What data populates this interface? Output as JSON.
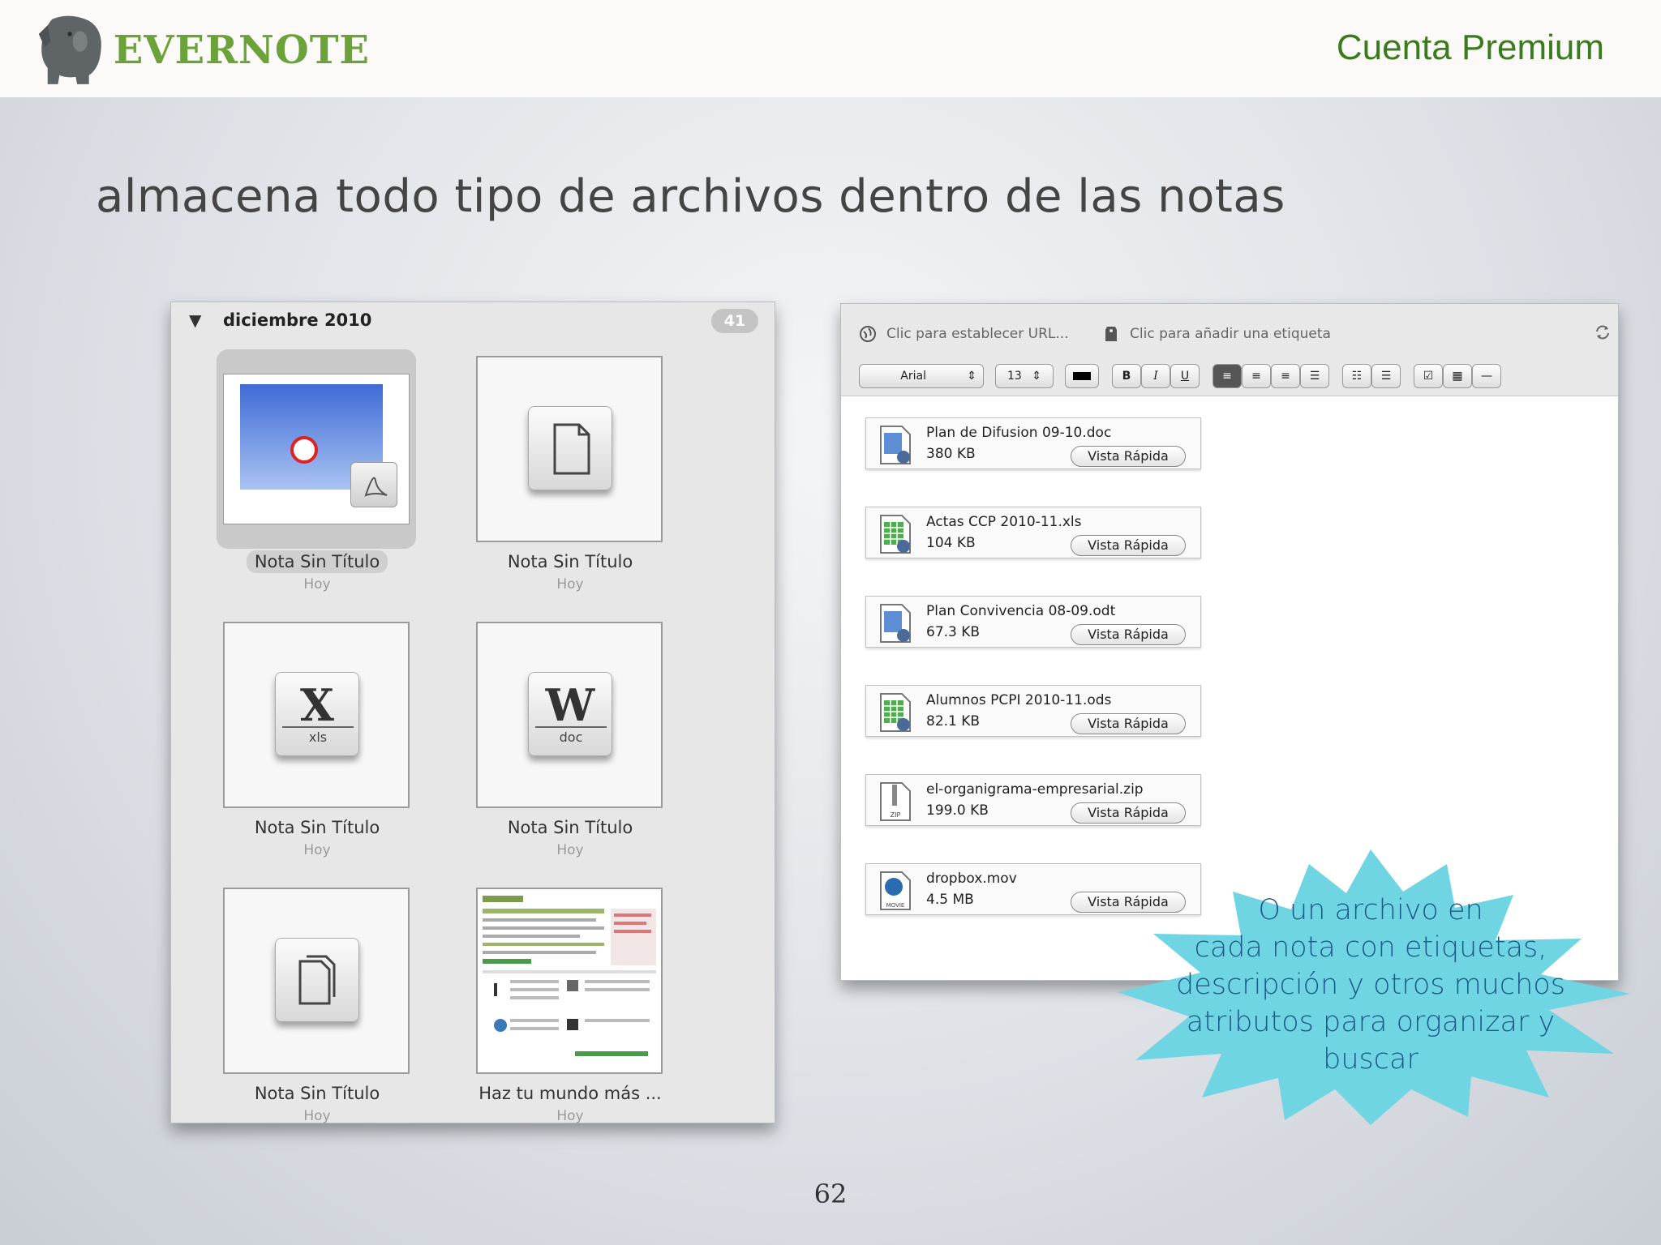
{
  "header": {
    "logo_text": "EVERNOTE",
    "section": "Cuenta Premium"
  },
  "slide": {
    "title": "almacena todo tipo de archivos dentro de las notas",
    "page_number": "62"
  },
  "notes_panel": {
    "month": "diciembre 2010",
    "count": "41",
    "notes": [
      {
        "title": "Nota Sin Título",
        "date": "Hoy",
        "thumb": "pdf-slide",
        "selected": true
      },
      {
        "title": "Nota Sin Título",
        "date": "Hoy",
        "thumb": "generic-file"
      },
      {
        "title": "Nota Sin Título",
        "date": "Hoy",
        "thumb": "xls",
        "letter": "X",
        "ext": "xls"
      },
      {
        "title": "Nota Sin Título",
        "date": "Hoy",
        "thumb": "doc",
        "letter": "W",
        "ext": "doc"
      },
      {
        "title": "Nota Sin Título",
        "date": "Hoy",
        "thumb": "copy-file"
      },
      {
        "title": "Haz tu mundo más ...",
        "date": "Hoy",
        "thumb": "webpage"
      }
    ]
  },
  "editor": {
    "url_placeholder": "Clic para establecer URL...",
    "tag_placeholder": "Clic para añadir una etiqueta",
    "font": "Arial",
    "size": "13",
    "bold": "B",
    "italic": "I",
    "underline": "U",
    "quick_look_label": "Vista Rápida",
    "attachments": [
      {
        "name": "Plan de Difusion 09-10.doc",
        "size": "380 KB",
        "icon": "document-icon"
      },
      {
        "name": "Actas CCP 2010-11.xls",
        "size": "104 KB",
        "icon": "spreadsheet-icon"
      },
      {
        "name": "Plan Convivencia 08-09.odt",
        "size": "67.3 KB",
        "icon": "document-icon"
      },
      {
        "name": "Alumnos PCPI 2010-11.ods",
        "size": "82.1 KB",
        "icon": "spreadsheet-icon"
      },
      {
        "name": "el-organigrama-empresarial.zip",
        "size": "199.0 KB",
        "icon": "zip-icon"
      },
      {
        "name": "dropbox.mov",
        "size": "4.5 MB",
        "icon": "movie-icon"
      }
    ]
  },
  "callout": {
    "lines": [
      "O   un archivo en",
      "cada nota con etiquetas,",
      "descripción y otros muchos",
      "atributos para organizar y",
      "buscar"
    ]
  },
  "colors": {
    "brand_green": "#6ba33a",
    "header_green": "#3b7a1e",
    "callout_fill": "#6fd5e2",
    "callout_text": "#1d5a8a"
  }
}
